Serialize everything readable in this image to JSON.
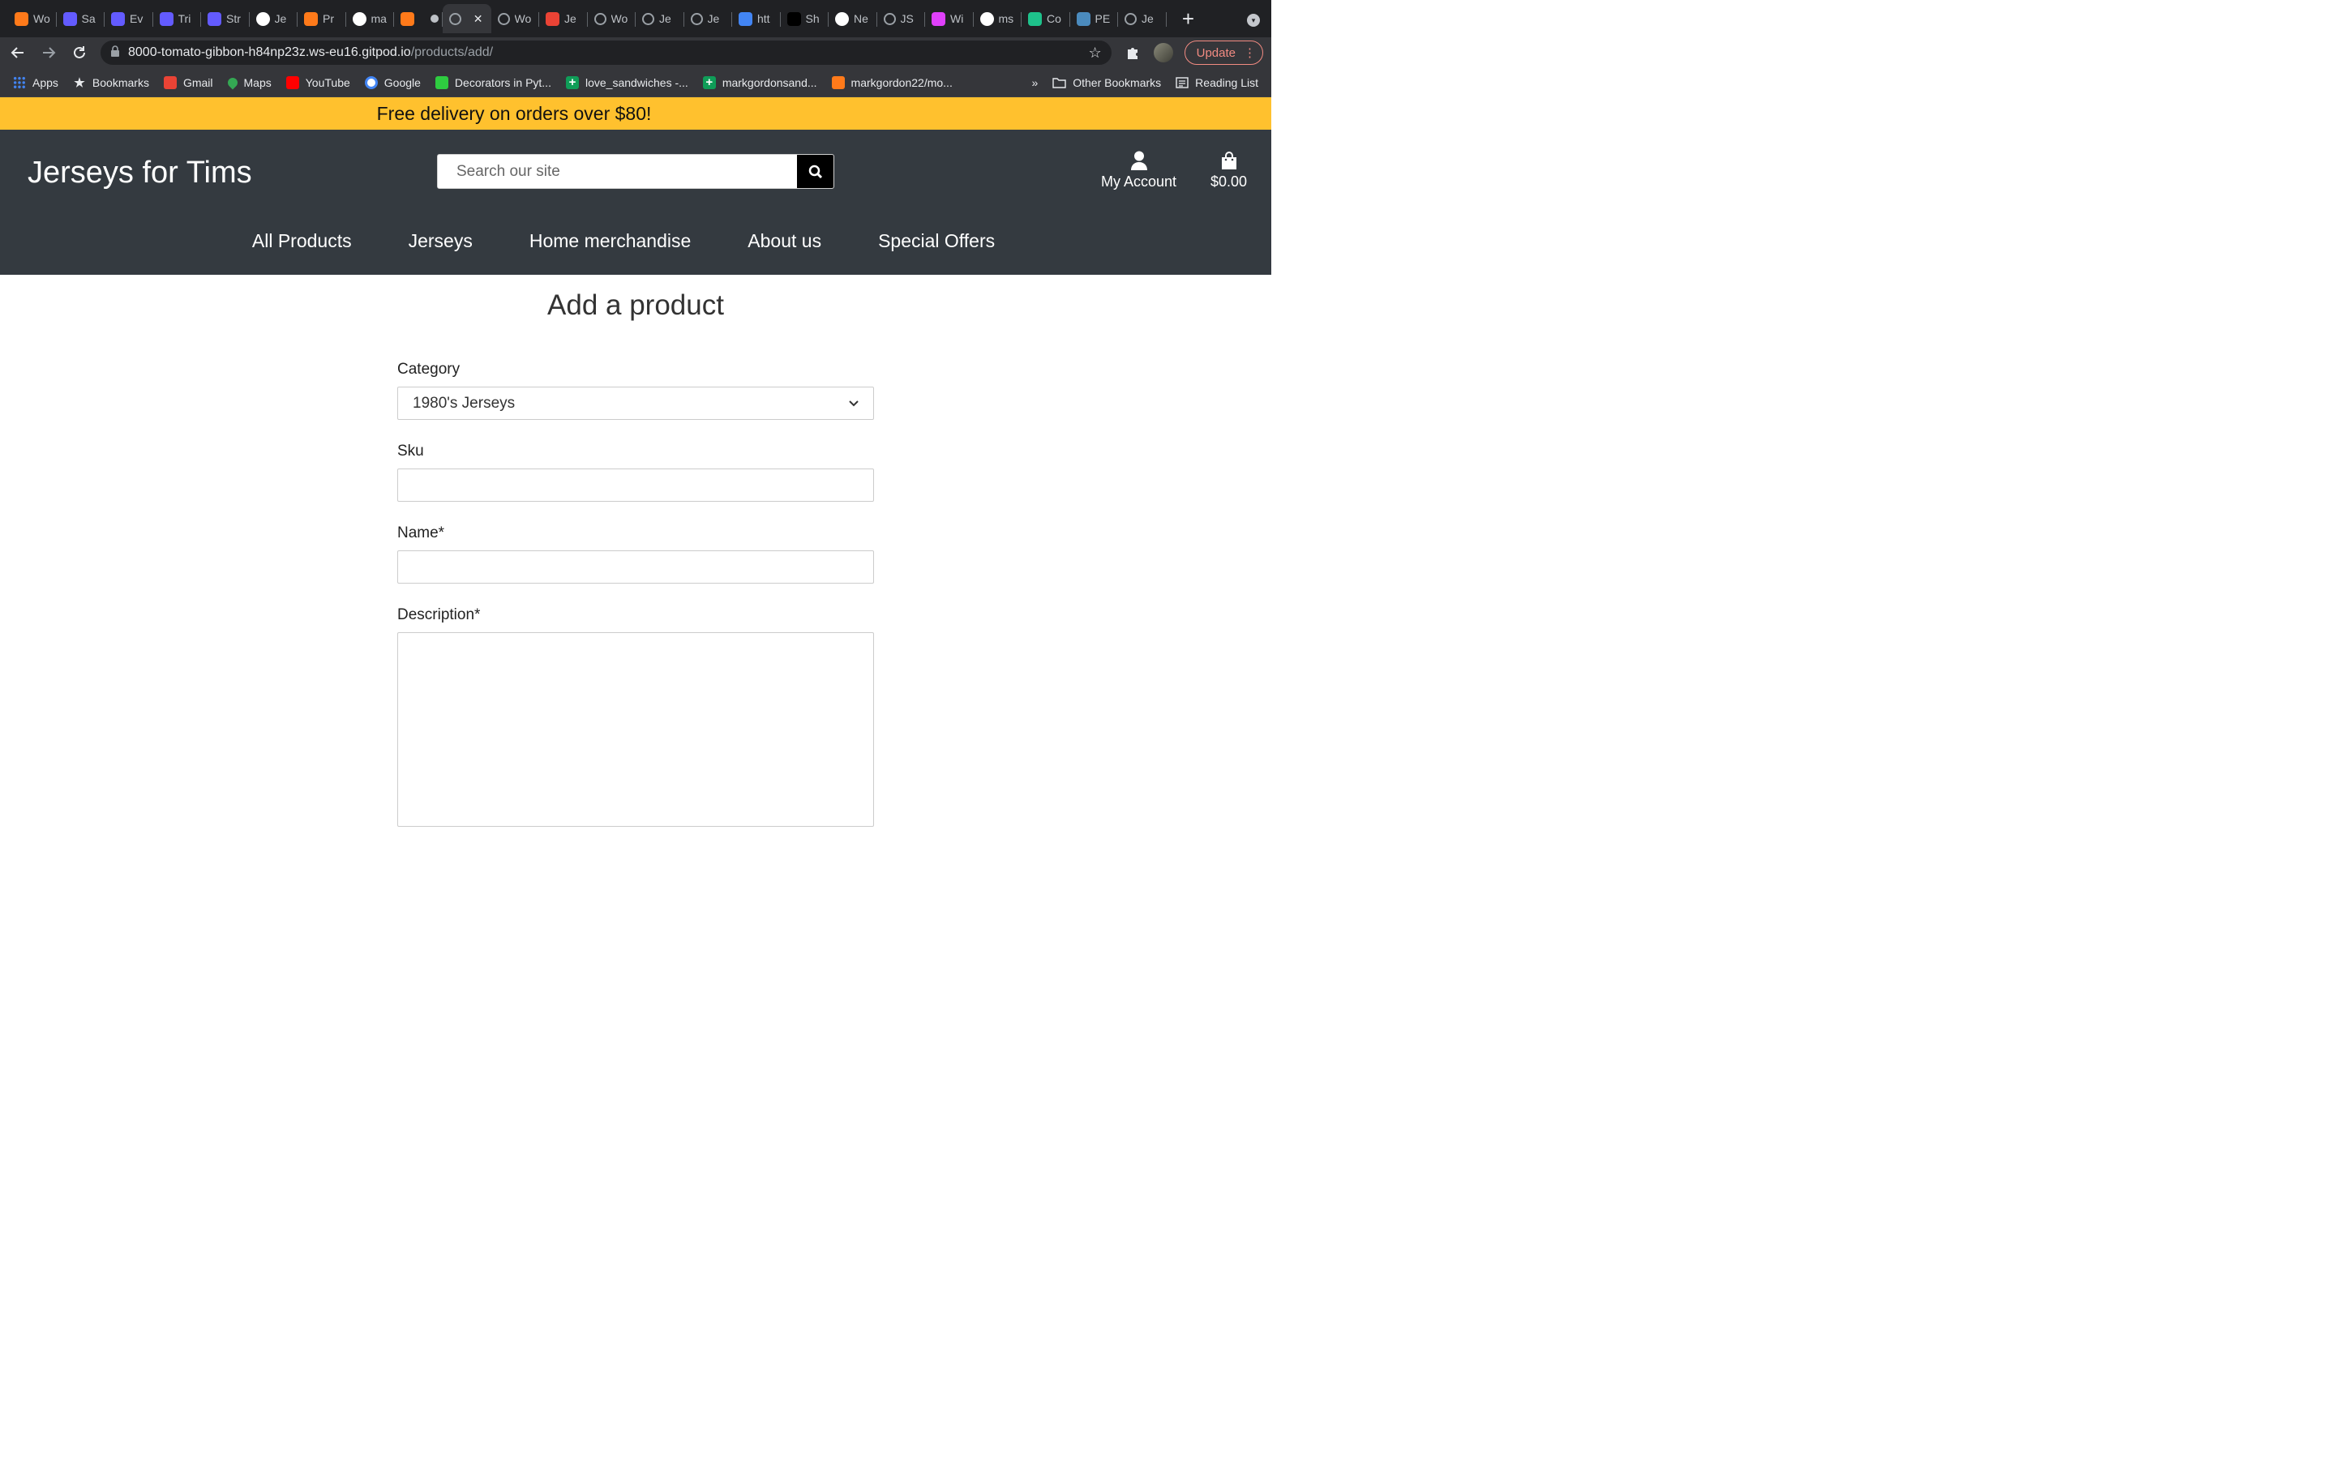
{
  "browser": {
    "tabs": [
      {
        "title": "Wo",
        "favicon": "g-orange-icon",
        "color": "#ff7a1a"
      },
      {
        "title": "Sa",
        "favicon": "s-stripe-icon",
        "color": "#635bff"
      },
      {
        "title": "Ev",
        "favicon": "s-stripe-icon",
        "color": "#635bff"
      },
      {
        "title": "Tri",
        "favicon": "s-stripe-icon",
        "color": "#635bff"
      },
      {
        "title": "Str",
        "favicon": "s-stripe-icon",
        "color": "#635bff"
      },
      {
        "title": "Je",
        "favicon": "github-icon",
        "color": "#ffffff"
      },
      {
        "title": "Pr",
        "favicon": "g-orange-icon",
        "color": "#ff7a1a"
      },
      {
        "title": "ma",
        "favicon": "github-icon",
        "color": "#ffffff"
      },
      {
        "title": "",
        "favicon": "g-orange-icon",
        "color": "#ff7a1a"
      },
      {
        "title": "",
        "favicon": "globe-icon",
        "color": "#9aa0a6",
        "active": true
      },
      {
        "title": "Wo",
        "favicon": "globe-icon",
        "color": "#9aa0a6"
      },
      {
        "title": "Je",
        "favicon": "gmail-icon",
        "color": "#ea4335"
      },
      {
        "title": "Wo",
        "favicon": "globe-icon",
        "color": "#9aa0a6"
      },
      {
        "title": "Je",
        "favicon": "globe-icon",
        "color": "#9aa0a6"
      },
      {
        "title": "Je",
        "favicon": "globe-icon",
        "color": "#9aa0a6"
      },
      {
        "title": "htt",
        "favicon": "google-icon",
        "color": "#4285f4"
      },
      {
        "title": "Sh",
        "favicon": "nu-icon",
        "color": "#000000"
      },
      {
        "title": "Ne",
        "favicon": "smiley-icon",
        "color": "#ffffff"
      },
      {
        "title": "JS",
        "favicon": "globe-icon",
        "color": "#9aa0a6"
      },
      {
        "title": "Wi",
        "favicon": "colorful-icon",
        "color": "#e040fb"
      },
      {
        "title": "ms",
        "favicon": "github-icon",
        "color": "#ffffff"
      },
      {
        "title": "Co",
        "favicon": "d-green-icon",
        "color": "#1ec28b"
      },
      {
        "title": "PE",
        "favicon": "pep8-icon",
        "color": "#4b8bbe"
      },
      {
        "title": "Je",
        "favicon": "globe-icon",
        "color": "#9aa0a6"
      }
    ],
    "url_host": "8000-tomato-gibbon-h84np23z.ws-eu16.gitpod.io",
    "url_path": "/products/add/",
    "update_label": "Update",
    "bookmarks": [
      {
        "label": "Apps",
        "icon": "apps-grid-icon",
        "color": "#4285f4"
      },
      {
        "label": "Bookmarks",
        "icon": "star-icon",
        "color": "#e8eaed"
      },
      {
        "label": "Gmail",
        "icon": "gmail-icon",
        "color": "#ea4335"
      },
      {
        "label": "Maps",
        "icon": "maps-pin-icon",
        "color": "#34a853"
      },
      {
        "label": "YouTube",
        "icon": "youtube-icon",
        "color": "#ff0000"
      },
      {
        "label": "Google",
        "icon": "google-icon",
        "color": "#4285f4"
      },
      {
        "label": "Decorators in Pyt...",
        "icon": "realpython-icon",
        "color": "#2ecc40"
      },
      {
        "label": "love_sandwiches -...",
        "icon": "sheets-icon",
        "color": "#0f9d58"
      },
      {
        "label": "markgordonsand...",
        "icon": "sheets-icon",
        "color": "#0f9d58"
      },
      {
        "label": "markgordon22/mo...",
        "icon": "g-orange-icon",
        "color": "#ff7a1a"
      }
    ],
    "overflow_label": "»",
    "other_bookmarks": "Other Bookmarks",
    "reading_list": "Reading List"
  },
  "site": {
    "banner": "Free delivery on orders over $80!",
    "logo": "Jerseys for Tims",
    "search_placeholder": "Search our site",
    "account_label": "My Account",
    "cart_total": "$0.00",
    "nav": [
      "All Products",
      "Jerseys",
      "Home merchandise",
      "About us",
      "Special Offers"
    ]
  },
  "form": {
    "title": "Add a product",
    "category_label": "Category",
    "category_value": "1980's Jerseys",
    "sku_label": "Sku",
    "name_label": "Name*",
    "description_label": "Description*"
  }
}
